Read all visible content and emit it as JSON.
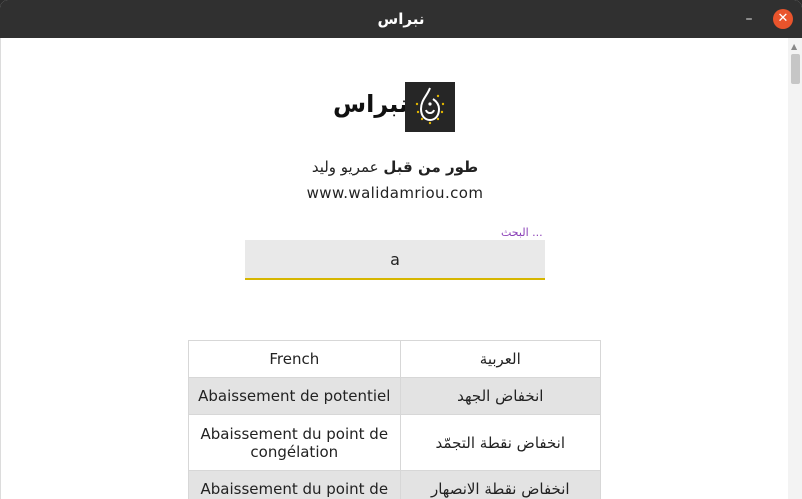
{
  "window": {
    "title": "نبراس",
    "minimize_label": "–",
    "close_label": "✕"
  },
  "header": {
    "logo_text": "نبراس",
    "logo_icon": "lamp-drop-icon",
    "credit_prefix": "طور من قبل",
    "credit_author": "عمريو وليد",
    "website": "www.walidamriou.com"
  },
  "search": {
    "label": "البحث ...",
    "value": "a"
  },
  "table": {
    "headers": {
      "french": "French",
      "arabic": "العربية"
    },
    "rows": [
      {
        "french": "Abaissement de potentiel",
        "arabic": "انخفاض الجهد"
      },
      {
        "french": "Abaissement du point de congélation",
        "arabic": "انخفاض نقطة التجمّد"
      },
      {
        "french": "Abaissement du point de",
        "arabic": "انخفاض نقطة الانصهار"
      }
    ]
  },
  "colors": {
    "titlebar": "#303030",
    "accent_underline": "#d6b600",
    "label_purple": "#8a3fb7",
    "close_button": "#e9542c"
  }
}
